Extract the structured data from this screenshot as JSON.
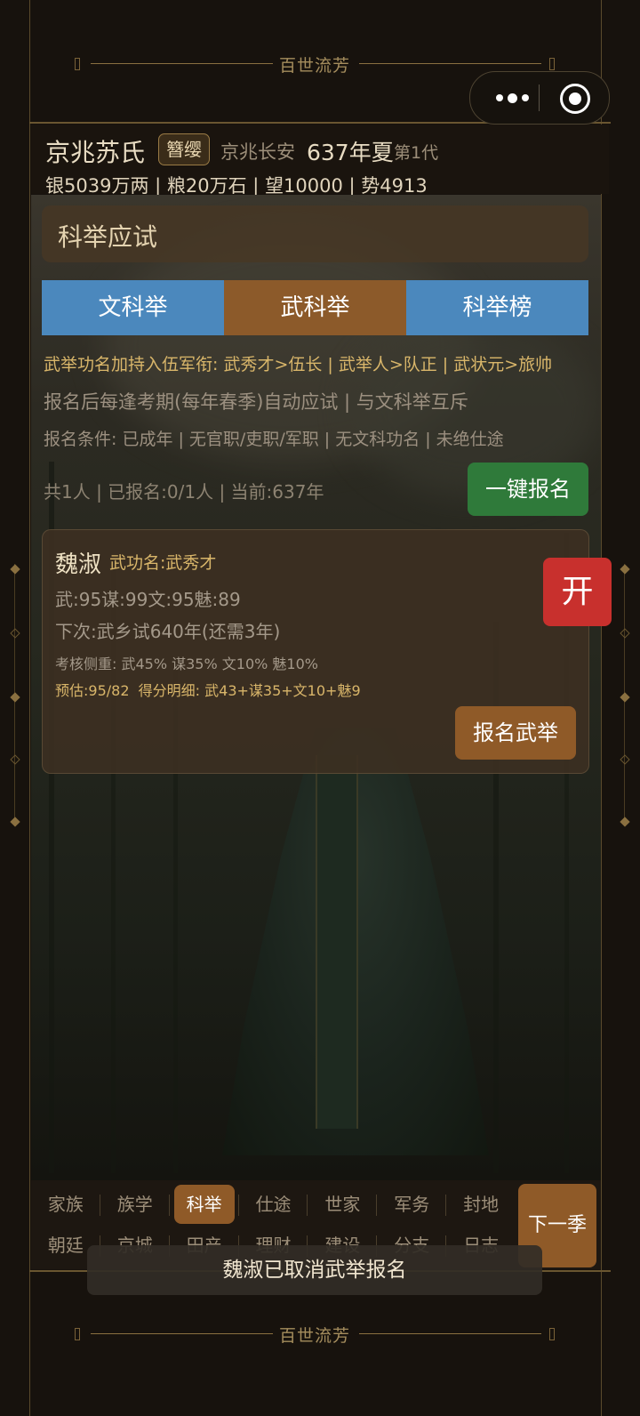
{
  "banner": {
    "top_text": "百世流芳",
    "bottom_text": "百世流芳"
  },
  "header": {
    "clan_name": "京兆苏氏",
    "rank_badge": "簪缨",
    "location": "京兆长安",
    "year_season": "637年夏",
    "generation": "第1代",
    "stats": "银5039万两 | 粮20万石 | 望10000 | 势4913"
  },
  "page": {
    "title": "科举应试",
    "tabs": [
      {
        "label": "文科举",
        "active": false
      },
      {
        "label": "武科举",
        "active": true
      },
      {
        "label": "科举榜",
        "active": false
      }
    ],
    "info_line1": "武举功名加持入伍军衔: 武秀才>伍长 | 武举人>队正 | 武状元>旅帅",
    "info_line2": "报名后每逢考期(每年春季)自动应试 | 与文科举互斥",
    "info_line3": "报名条件: 已成年 | 无官职/吏职/军职 | 无文科功名 | 未绝仕途",
    "count_line": "共1人 | 已报名:0/1人 | 当前:637年",
    "one_click_button": "一键报名"
  },
  "candidate": {
    "name": "魏淑",
    "title": "武功名:武秀才",
    "attributes": "武:95谋:99文:95魅:89",
    "next_exam": "下次:武乡试640年(还需3年)",
    "weights": "考核侧重: 武45% 谋35% 文10% 魅10%",
    "estimate": "预估:95/82  得分明细: 武43+谋35+文10+魅9",
    "register_button": "报名武举"
  },
  "open_button": "开",
  "nav": {
    "row1": [
      "家族",
      "族学",
      "科举",
      "仕途",
      "世家",
      "军务",
      "封地"
    ],
    "row2": [
      "朝廷",
      "京城",
      "田产",
      "理财",
      "建设",
      "分支",
      "日志"
    ],
    "active": "科举",
    "next_season": "下一季"
  },
  "toast": "魏淑已取消武举报名",
  "colors": {
    "tab_blue": "#4b88bd",
    "tab_active_brown": "#8c5a2a",
    "green_button": "#2f7a3a",
    "red_button": "#c8302d",
    "gold_text": "#d9b66a"
  }
}
